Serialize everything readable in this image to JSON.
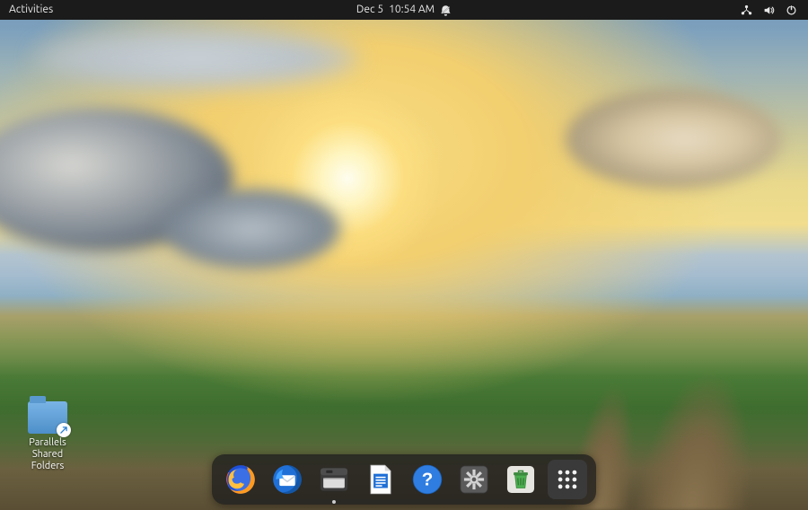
{
  "topbar": {
    "activities_label": "Activities",
    "date": "Dec 5",
    "time": "10:54 AM"
  },
  "desktop_icons": [
    {
      "label": "Parallels Shared\nFolders"
    }
  ],
  "dock": {
    "items": [
      {
        "name": "firefox"
      },
      {
        "name": "thunderbird"
      },
      {
        "name": "files"
      },
      {
        "name": "libreoffice-writer"
      },
      {
        "name": "help"
      },
      {
        "name": "settings"
      },
      {
        "name": "trash"
      },
      {
        "name": "app-grid"
      }
    ]
  }
}
